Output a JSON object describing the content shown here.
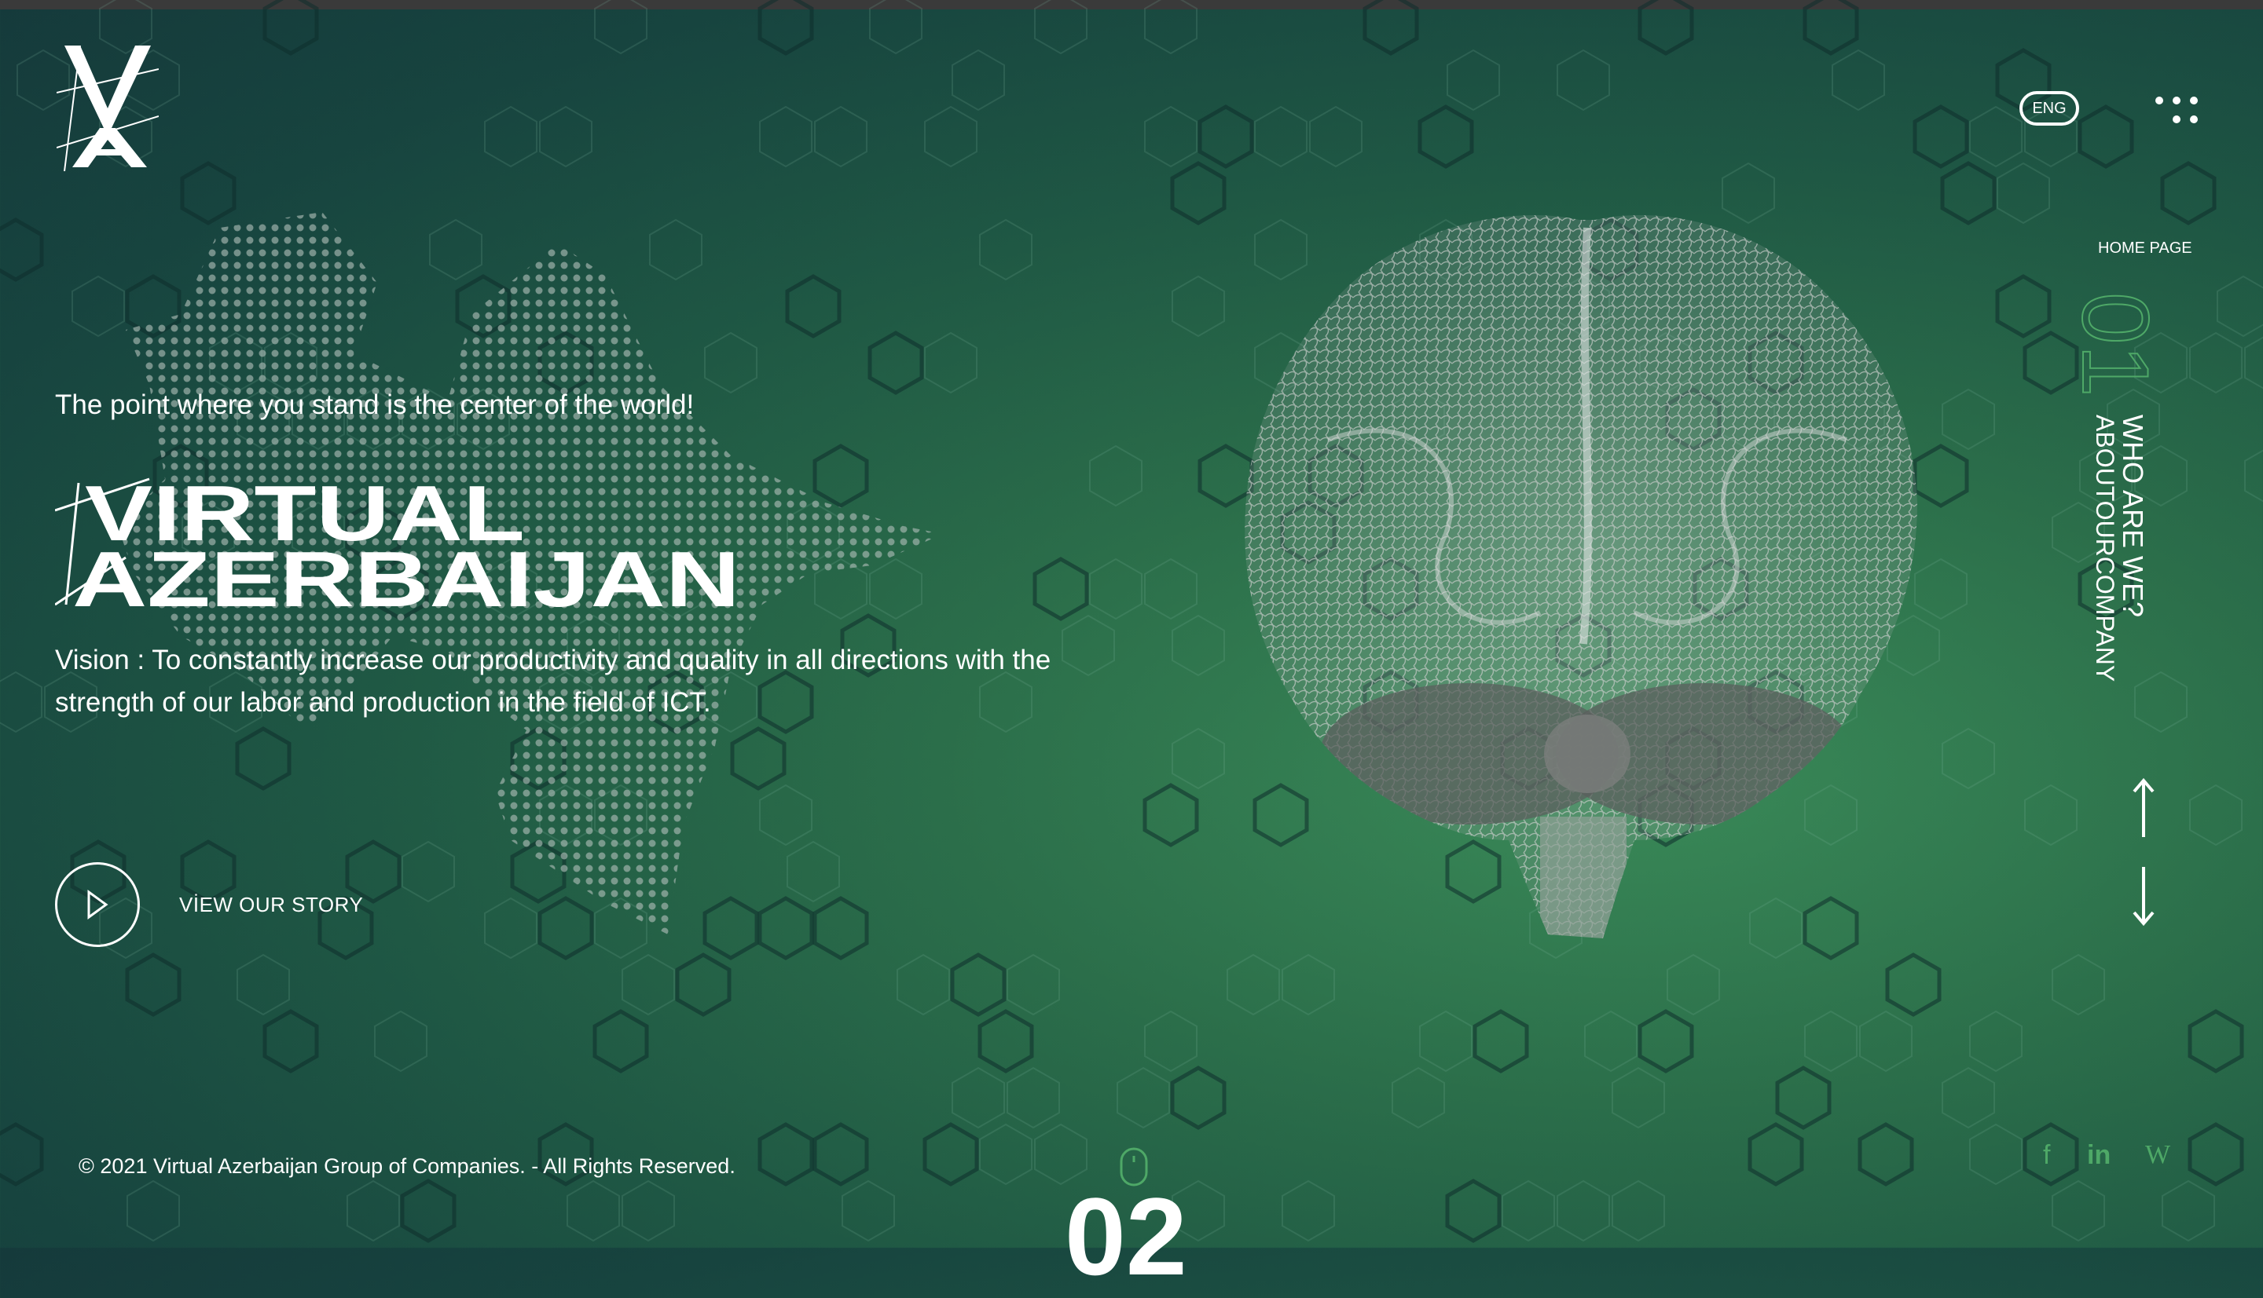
{
  "header": {
    "logo_text": "VA",
    "language": "ENG",
    "menu_icon": "dots-menu-icon"
  },
  "hero": {
    "tagline": "The point where you stand is the center of the world!",
    "title_line1": "VIRTUAL",
    "title_line2": "AZERBAIJAN",
    "vision": "Vision : To constantly increase our productivity and quality in all directions with the strength of our labor and production in the field of ICT.",
    "story_link": "VİEW OUR STORY",
    "play_icon": "play-icon"
  },
  "side_nav": {
    "home_label": "HOME PAGE",
    "section_number": "01",
    "heading": "WHO ARE WE?",
    "subheading": "ABOUTOURCOMPANY",
    "up_icon": "arrow-up-icon",
    "down_icon": "arrow-down-icon"
  },
  "footer": {
    "copyright": "© 2021 Virtual Azerbaijan Group of Companies. - All Rights Reserved.",
    "next_section_number": "02",
    "scroll_icon": "mouse-scroll-icon",
    "social": [
      {
        "name": "facebook",
        "glyph": "f"
      },
      {
        "name": "linkedin",
        "glyph": "in"
      },
      {
        "name": "wikipedia",
        "glyph": "W"
      }
    ]
  },
  "colors": {
    "accent": "#4ea867",
    "background_dark": "#153a3b",
    "background_light": "#3a8a58"
  }
}
